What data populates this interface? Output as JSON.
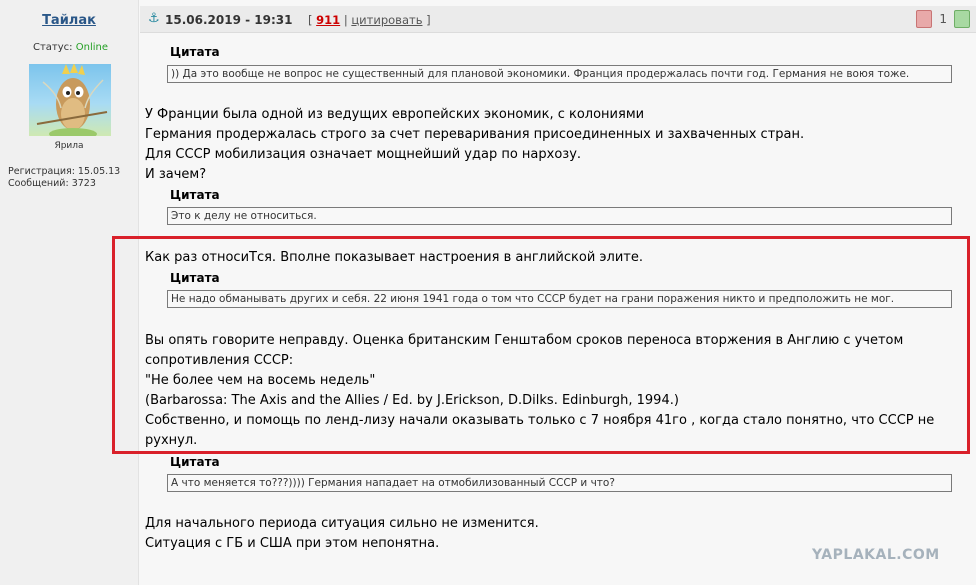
{
  "user": {
    "name": "Тайлак",
    "status_label": "Статус:",
    "status_value": "Online",
    "avatar_caption": "Ярила",
    "registration": "Регистрация: 15.05.13",
    "messages": "Сообщений: 3723"
  },
  "post": {
    "datetime": "15.06.2019 - 19:31",
    "number": "911",
    "cite_label": "цитировать",
    "rating_count": "1"
  },
  "quote_label": "Цитата",
  "quotes": [
    ")) Да это вообще не вопрос не существенный для плановой экономики. Франция продержалась почти год. Германия не воюя тоже.",
    "Это к делу не относиться.",
    "Не надо обманывать других и себя. 22 июня 1941 года о том что СССР будет на грани поражения никто и предположить не мог.",
    "А что меняется то???)))) Германия нападает на отмобилизованный СССР и что?"
  ],
  "text_blocks": [
    [
      "У Франции была одной из ведущих европейских экономик, с колониями",
      "Германия продержалась строго за счет переваривания присоединенных и захваченных стран.",
      "Для СССР мобилизация означает мощнейший удар по нархозу.",
      "И зачем?"
    ],
    [
      "Как раз относиТся. Вполне показывает настроения в английской элите."
    ],
    [
      "Вы опять говорите неправду. Оценка британским Генштабом сроков переноса вторжения в Англию с учетом",
      "сопротивления СССР:",
      "\"Не более чем на восемь недель\"",
      "(Barbarossa: The Axis and the Allies / Ed. by J.Erickson, D.Dilks. Edinburgh, 1994.)",
      "Собственно, и помощь по ленд-лизу начали оказывать только с 7 ноября 41го , когда стало понятно, что СССР не",
      "рухнул."
    ],
    [
      "Для начального периода ситуация сильно не изменится.",
      "Ситуация с ГБ и США при этом непонятна."
    ]
  ],
  "watermark": "YAPLAKAL.COM",
  "colors": {
    "highlight": "#d9202a",
    "username": "#2a5788",
    "online": "#25a025",
    "post_number": "#cc0000"
  },
  "icons": {
    "anchor": "anchor-icon",
    "down": "thumb-down-icon",
    "up": "thumb-up-icon"
  }
}
